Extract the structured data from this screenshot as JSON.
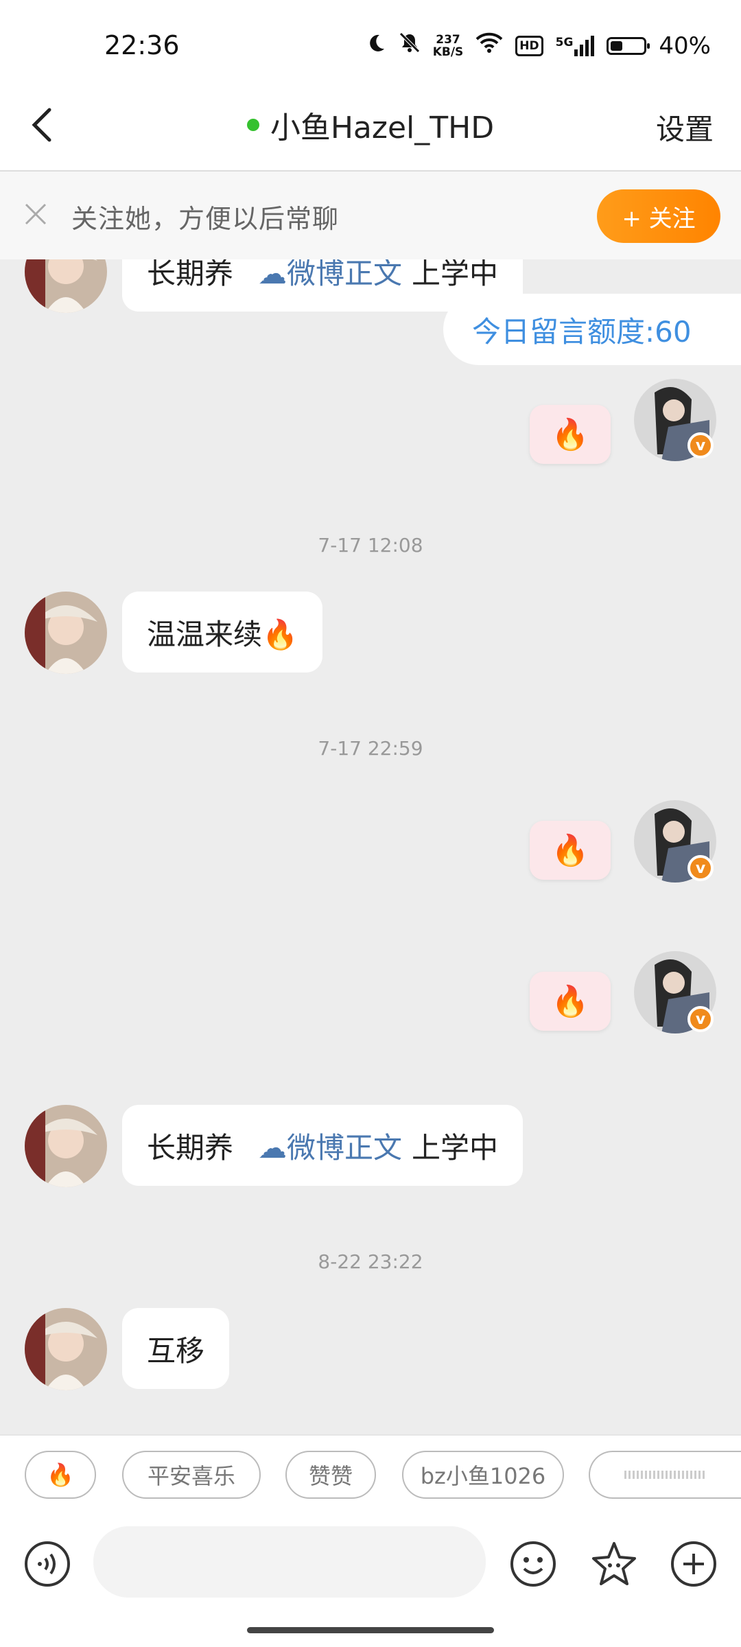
{
  "status_bar": {
    "time": "22:36",
    "net_speed_value": "237",
    "net_speed_unit": "KB/S",
    "hd": "HD",
    "signal_label": "5G",
    "battery": "40%",
    "icons": [
      "moon-icon",
      "mute-bell-icon",
      "wifi-icon",
      "signal-icon",
      "battery-icon"
    ]
  },
  "header": {
    "title": "小鱼Hazel_THD",
    "settings_label": "设置",
    "online_color": "#35c12f"
  },
  "follow_banner": {
    "text": "关注她，方便以后常聊",
    "button_label": "+ 关注"
  },
  "chat": {
    "top_partial": {
      "left": "长期养",
      "link": "微博正文",
      "right": "上学中"
    },
    "quota_text": "今日留言额度:60",
    "timestamps": [
      "7-17 12:08",
      "7-17 22:59",
      "8-22 23:22"
    ],
    "msg_wenwen": "温温来续🔥",
    "msg_fire": "🔥",
    "repeat": {
      "left": "长期养",
      "link": "微博正文",
      "right": "上学中"
    },
    "msg_last": "互移"
  },
  "quick_replies": [
    "🔥",
    "平安喜乐",
    "赞赞",
    "bz小鱼1026"
  ],
  "input": {
    "placeholder": ""
  },
  "colors": {
    "accent": "#ff8c00",
    "link": "#4a78b0",
    "quota": "#3f8fe0"
  }
}
